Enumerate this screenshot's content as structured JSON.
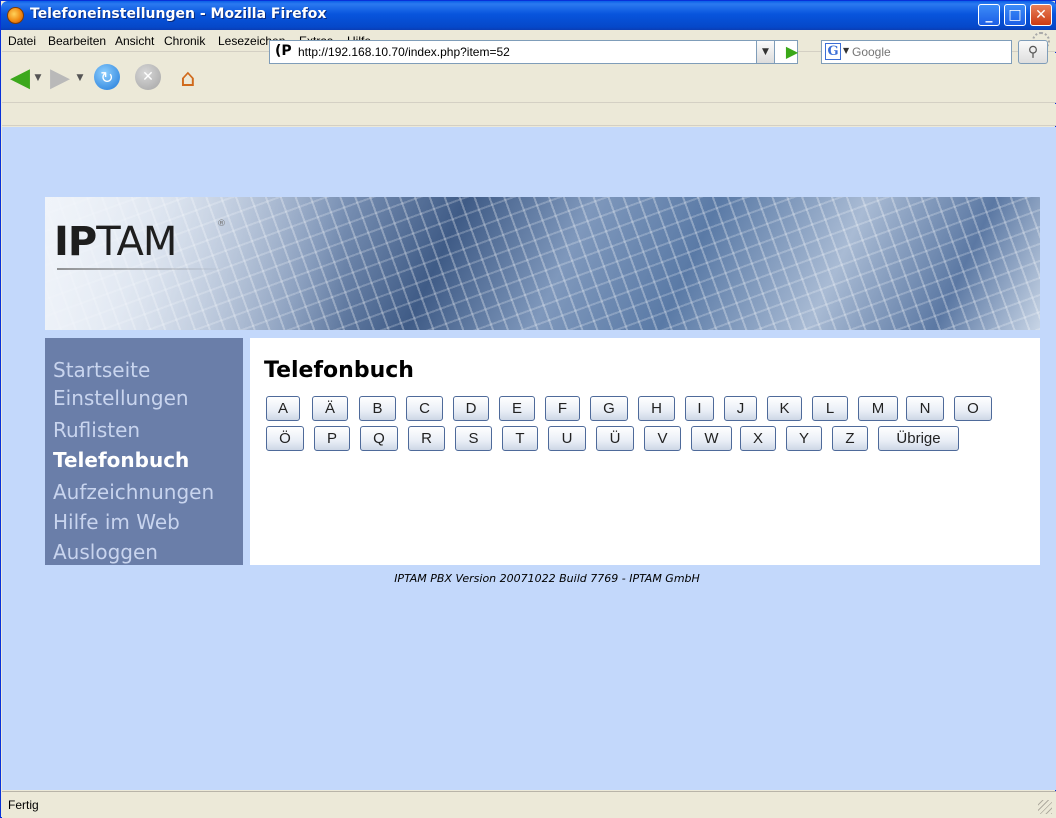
{
  "window": {
    "title": "Telefoneinstellungen - Mozilla Firefox",
    "controls": {
      "minimize": "_",
      "maximize": "□",
      "close": "✕"
    }
  },
  "menu": [
    "Datei",
    "Bearbeiten",
    "Ansicht",
    "Chronik",
    "Lesezeichen",
    "Extras",
    "Hilfe"
  ],
  "toolbar": {
    "url": "http://192.168.10.70/index.php?item=52",
    "url_favicon": "(P",
    "search_placeholder": "Google",
    "search_engine_letter": "G",
    "icons": [
      "back-arrow-icon",
      "forward-arrow-icon",
      "reload-icon",
      "stop-icon",
      "home-icon",
      "go-arrow-icon",
      "magnifier-icon"
    ]
  },
  "page": {
    "logo_bold": "IP",
    "logo_rest": "TAM",
    "logo_mark": "®",
    "nav": [
      {
        "label": "Startseite",
        "active": false
      },
      {
        "label": "Einstellungen",
        "active": false
      },
      {
        "label": "Ruflisten",
        "active": false
      },
      {
        "label": "Telefonbuch",
        "active": true
      },
      {
        "label": "Aufzeichnungen",
        "active": false
      },
      {
        "label": "Hilfe im Web",
        "active": false
      },
      {
        "label": "Ausloggen",
        "active": false
      }
    ],
    "title": "Telefonbuch",
    "letters_row1": [
      "A",
      "Ä",
      "B",
      "C",
      "D",
      "E",
      "F",
      "G",
      "H",
      "I",
      "J",
      "K",
      "L",
      "M",
      "N",
      "O"
    ],
    "letters_row2": [
      "Ö",
      "P",
      "Q",
      "R",
      "S",
      "T",
      "U",
      "Ü",
      "V",
      "W",
      "X",
      "Y",
      "Z",
      "Übrige"
    ],
    "footer": "IPTAM PBX Version 20071022 Build 7769 - IPTAM GmbH",
    "colors": {
      "background": "#c3d8fb",
      "nav": "#6a7ea9",
      "nav_text": "#c8d4ee",
      "nav_active": "#ffffff"
    }
  },
  "status": {
    "text": "Fertig"
  }
}
